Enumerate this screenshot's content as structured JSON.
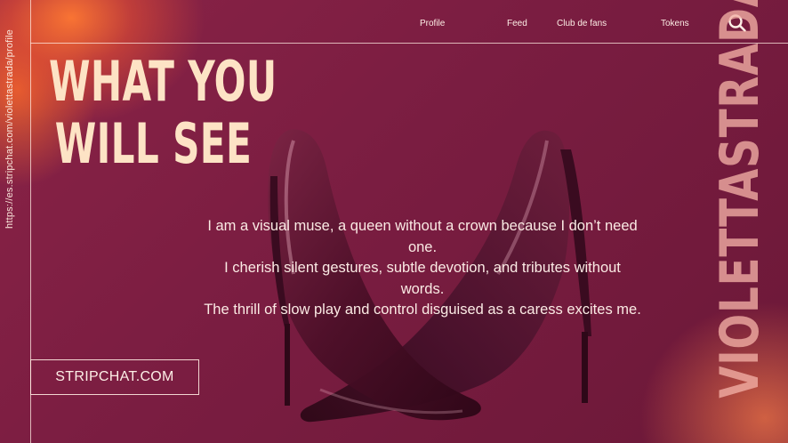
{
  "side_url": "https://es.stripchat.com/violettastrada/profile",
  "nav": {
    "profile": "Profile",
    "feed": "Feed",
    "fans": "Club de fans",
    "tokens": "Tokens"
  },
  "icons": {
    "search": "search-icon",
    "shoes": "high-heels-image"
  },
  "heading": {
    "line1": "WHAT YOU",
    "line2": "WILL SEE"
  },
  "body_lines": [
    "I am a visual muse, a queen without a crown because I don’t need",
    "one.",
    "I cherish silent gestures, subtle devotion, and tributes without",
    "words.",
    "The thrill of slow play and control disguised as a caress excites me."
  ],
  "cta_label": "STRIPCHAT.COM",
  "brand_vertical": "VIOLETTASTRADA",
  "colors": {
    "background": "#7a1c3e",
    "accent_orange": "#f0783a",
    "heading": "#fde3c5",
    "text": "#fbeae4"
  }
}
